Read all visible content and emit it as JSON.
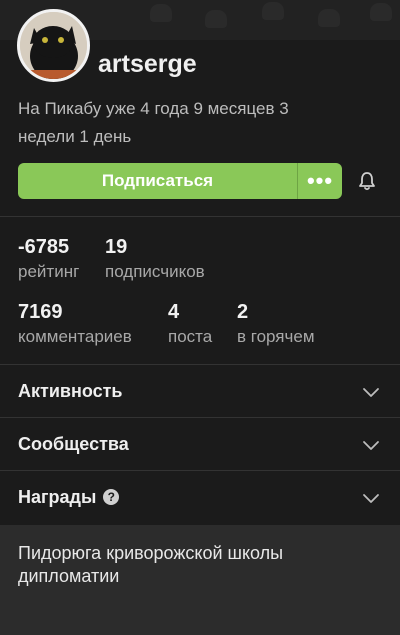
{
  "profile": {
    "username": "artserge",
    "since": "На Пикабу уже 4 года 9 месяцев 3 недели 1 день"
  },
  "actions": {
    "subscribe_label": "Подписаться",
    "more_label": "•••"
  },
  "stats": [
    {
      "value": "-6785",
      "label": "рейтинг"
    },
    {
      "value": "19",
      "label": "подписчиков"
    },
    {
      "value": "7169",
      "label": "комментариев"
    },
    {
      "value": "4",
      "label": "поста"
    },
    {
      "value": "2",
      "label": "в горячем"
    }
  ],
  "sections": [
    {
      "label": "Активность"
    },
    {
      "label": "Сообщества"
    },
    {
      "label": "Награды",
      "help": "?"
    }
  ],
  "about": "Пидорюга криворожской школы дипломатии",
  "colors": {
    "accent": "#8ac858",
    "background": "#1b1b1b",
    "panel": "#2c2c2c"
  }
}
